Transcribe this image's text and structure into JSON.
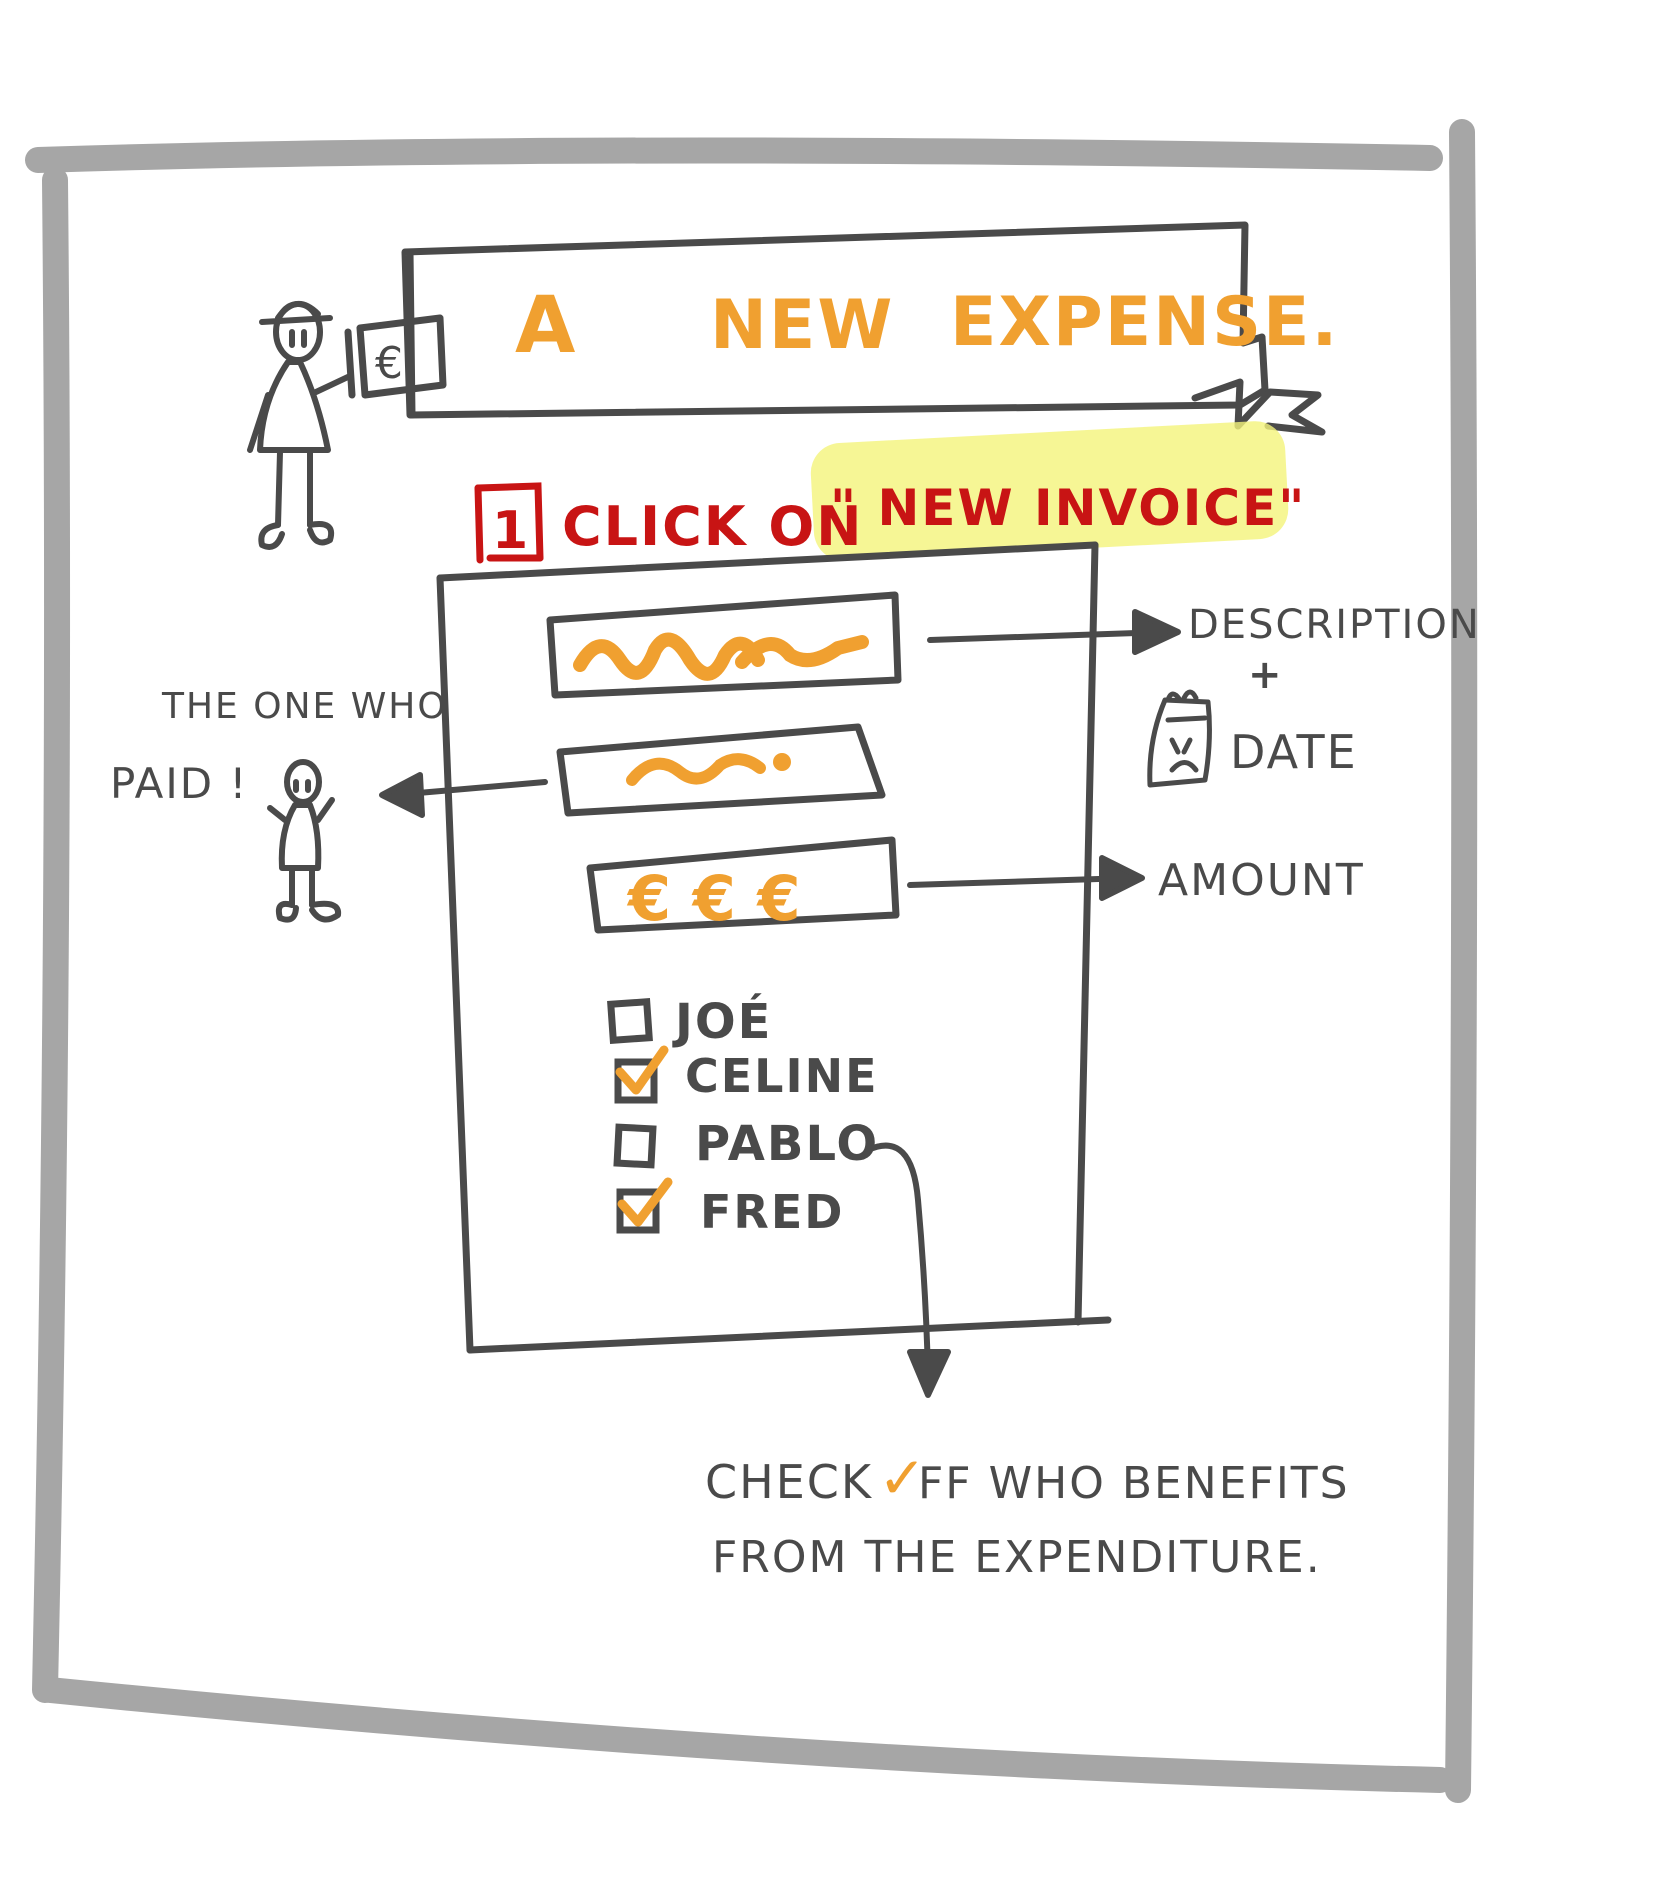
{
  "colors": {
    "frame": "#a6a6a6",
    "ink": "#4a4a4a",
    "orange": "#f0a030",
    "red": "#c81414",
    "highlight": "#f4f47a"
  },
  "banner": {
    "word_a": "A",
    "word_new": "NEW",
    "word_expense": "EXPENSE."
  },
  "banner_tag": "€",
  "step": {
    "number": "1",
    "text": "CLICK ON",
    "quoted": "\" NEW  INVOICE\""
  },
  "form": {
    "amount_symbols": "€ € €",
    "participants": [
      {
        "name": "JOÉ",
        "checked": false
      },
      {
        "name": "CELINE",
        "checked": true
      },
      {
        "name": "PABLO",
        "checked": false
      },
      {
        "name": "FRED",
        "checked": true
      }
    ]
  },
  "annotations": {
    "description": "DESCRIPTION",
    "plus": "+",
    "date": "DATE",
    "amount": "AMOUNT",
    "payer_line1": "THE ONE WHO",
    "payer_line2": "PAID !",
    "check_line1_a": "CHECK",
    "check_mark": "✓",
    "check_line1_b": "FF WHO BENEFITS",
    "check_line2": "FROM THE EXPENDITURE."
  },
  "icons": {
    "presenter": "presenter-stick-figure-icon",
    "payer": "payer-stick-figure-icon",
    "calendar": "calendar-doodle-icon"
  }
}
